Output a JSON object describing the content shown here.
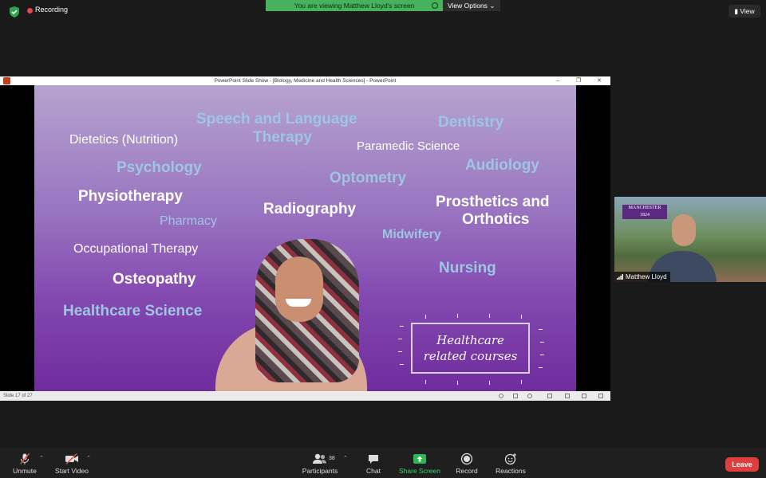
{
  "topbar": {
    "recording_label": "Recording",
    "share_banner": "You are viewing Matthew Lloyd's screen",
    "view_options": "View Options",
    "view_button": "View"
  },
  "ppt": {
    "window_title": "PowerPoint Slide Show - [Biology, Medicine and Health Sciences] - PowerPoint",
    "status_slide": "Slide 17 of 27"
  },
  "slide": {
    "speech": "Speech and Language",
    "therapy": "Therapy",
    "dentistry": "Dentistry",
    "dietetics": "Dietetics (Nutrition)",
    "paramedic": "Paramedic Science",
    "psychology": "Psychology",
    "audiology": "Audiology",
    "optometry": "Optometry",
    "physiotherapy": "Physiotherapy",
    "prosthetics1": "Prosthetics and",
    "prosthetics2": "Orthotics",
    "pharmacy": "Pharmacy",
    "radiography": "Radiography",
    "midwifery": "Midwifery",
    "occupational": "Occupational Therapy",
    "nursing": "Nursing",
    "osteopathy": "Osteopathy",
    "healthcare_science": "Healthcare Science",
    "box_line1": "Healthcare",
    "box_line2": "related courses"
  },
  "participant": {
    "name": "Matthew Lloyd",
    "logo_line1": "MANCHESTER",
    "logo_line2": "1824"
  },
  "toolbar": {
    "unmute": "Unmute",
    "start_video": "Start Video",
    "participants": "Participants",
    "participant_count": "38",
    "chat": "Chat",
    "share_screen": "Share Screen",
    "record": "Record",
    "reactions": "Reactions",
    "leave": "Leave"
  },
  "colors": {
    "share_green": "#47b25c",
    "leave_red": "#e03e3e",
    "slide_purple": "#8348b0",
    "course_blue": "#9dc6e3"
  }
}
